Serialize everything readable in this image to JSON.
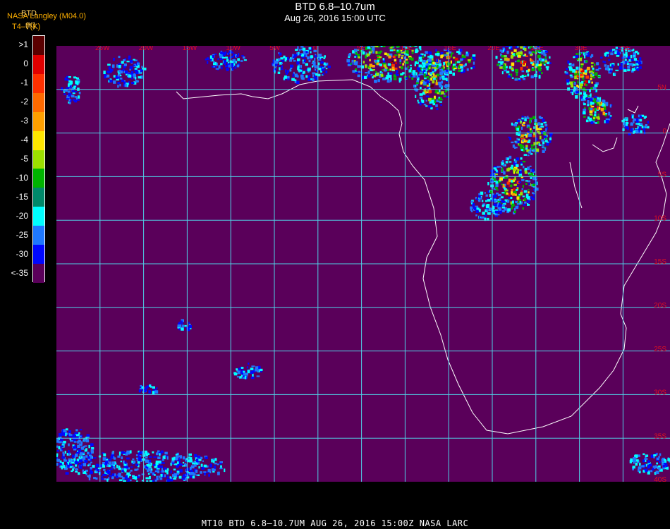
{
  "header": {
    "title": "BTD 6.8–10.7um",
    "subtitle": "Aug 26, 2016 15:00 UTC"
  },
  "overlay": {
    "source_a": "NASA Langley (M04.0)",
    "source_b": "BTD",
    "units_a": "T4–T(K)",
    "units_b": "(K)"
  },
  "colorbar": {
    "labels": [
      ">1",
      "0",
      "-1",
      "-2",
      "-3",
      "-4",
      "-5",
      "-10",
      "-15",
      "-20",
      "-25",
      "-30",
      "<-35"
    ],
    "colors": [
      "#5a0000",
      "#e00000",
      "#ff3000",
      "#ff6a00",
      "#ffa000",
      "#ffe600",
      "#9ce000",
      "#00b400",
      "#00886a",
      "#00ffff",
      "#1e78ff",
      "#0008ff",
      "#5a005a"
    ]
  },
  "map": {
    "background": "#5a005a",
    "grid_color": "#4fd2e6",
    "label_color": "#e01020",
    "coast_color": "#ffffff",
    "lon_labels": [
      "25W",
      "20W",
      "15W",
      "10W",
      "5W",
      "0",
      "5E",
      "10E",
      "15E",
      "20E",
      "25E",
      "30E",
      "35E"
    ],
    "lat_labels": [
      "5N",
      "0",
      "5S",
      "10S",
      "15S",
      "20S",
      "25S",
      "30S",
      "35S",
      "40S"
    ]
  },
  "footer": "MT10  BTD 6.8–10.7UM   AUG 26, 2016 15:00Z  NASA LARC"
}
